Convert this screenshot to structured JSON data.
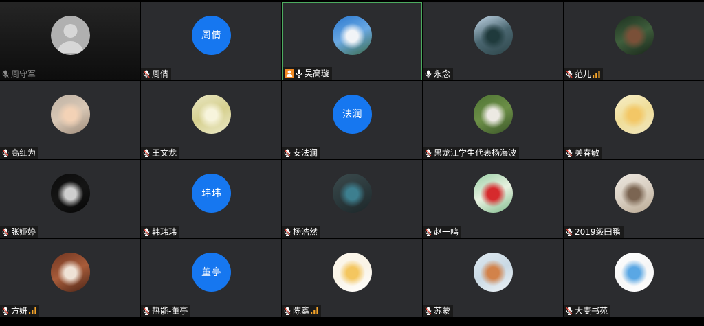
{
  "colors": {
    "page_background": "#000000",
    "tile_background": "#2b2c2f",
    "label_background": "#1a1a1a",
    "active_speaker_border": "#4cab5f",
    "text_avatar_background": "#1677f0",
    "mic_muted_slash": "#e6483a",
    "host_badge": "#f28b24",
    "signal_bars": "#f3a32a",
    "dimmed_label_text": "#8c8c8c"
  },
  "participants": [
    {
      "name": "周守军",
      "mic_icon": "mic-muted-icon",
      "dimmed": true,
      "avatar": {
        "icon": "default-user-icon",
        "colors": [
          "#b0b0b0",
          "#d7d7d7"
        ]
      }
    },
    {
      "name": "周倩",
      "mic_icon": "mic-muted-icon",
      "avatar": {
        "text": "周倩"
      }
    },
    {
      "name": "吴高璇",
      "mic_icon": "mic-on-icon",
      "host_icon": "host-icon",
      "active_speaker": true,
      "avatar": {
        "photo_colors": [
          "#2a78d0",
          "#6aa8e2",
          "#3b6b4a"
        ],
        "subject_color": "#f1f4f7"
      }
    },
    {
      "name": "永念",
      "mic_icon": "mic-on-icon",
      "avatar": {
        "photo_colors": [
          "#c5d9ea",
          "#4a6670",
          "#2d4549"
        ],
        "subject_color": "#1f3a3c"
      }
    },
    {
      "name": "范儿",
      "mic_icon": "mic-muted-icon",
      "signal_icon": "network-signal-icon",
      "avatar": {
        "photo_colors": [
          "#1c2f1f",
          "#3f5e3c",
          "#182519"
        ],
        "subject_color": "#7a5038"
      }
    },
    {
      "name": "高红为",
      "mic_icon": "mic-muted-icon",
      "avatar": {
        "photo_colors": [
          "#bfb2a4",
          "#d8c7b5",
          "#9d8b7a"
        ],
        "subject_color": "#f3d2b6"
      }
    },
    {
      "name": "王文龙",
      "mic_icon": "mic-muted-icon",
      "avatar": {
        "photo_colors": [
          "#e9e6c2",
          "#d6d08f",
          "#eceac9"
        ],
        "subject_color": "#f7f4dc"
      }
    },
    {
      "name": "安法润",
      "mic_icon": "mic-muted-icon",
      "avatar": {
        "text": "法润"
      }
    },
    {
      "name": "黑龙江学生代表杨海波",
      "mic_icon": "mic-muted-icon",
      "avatar": {
        "photo_colors": [
          "#4f7434",
          "#6c8f47",
          "#3a5528"
        ],
        "subject_color": "#ece9e2"
      }
    },
    {
      "name": "关春敏",
      "mic_icon": "mic-muted-icon",
      "avatar": {
        "photo_colors": [
          "#f6eec8",
          "#f0dd98",
          "#efe6bd"
        ],
        "subject_color": "#f3c766"
      }
    },
    {
      "name": "张娅婷",
      "mic_icon": "mic-muted-icon",
      "avatar": {
        "photo_colors": [
          "#0b0b0b",
          "#151515",
          "#050505"
        ],
        "subject_color": "#cfcfcf"
      }
    },
    {
      "name": "韩玮玮",
      "mic_icon": "mic-muted-icon",
      "avatar": {
        "text": "玮玮"
      }
    },
    {
      "name": "杨浩然",
      "mic_icon": "mic-muted-icon",
      "avatar": {
        "photo_colors": [
          "#3b4a4c",
          "#2c3a3d",
          "#1d2729"
        ],
        "subject_color": "#3d7f8f"
      }
    },
    {
      "name": "赵一鸣",
      "mic_icon": "mic-muted-icon",
      "avatar": {
        "photo_colors": [
          "#9acfa6",
          "#e8f1e0",
          "#7fbb8c"
        ],
        "subject_color": "#d62a2d"
      }
    },
    {
      "name": "2019级田鹏",
      "mic_icon": "mic-muted-icon",
      "avatar": {
        "photo_colors": [
          "#ece7df",
          "#d9cfc2",
          "#b9a993"
        ],
        "subject_color": "#7b6552"
      }
    },
    {
      "name": "方妍",
      "mic_icon": "mic-muted-icon",
      "signal_icon": "network-signal-icon",
      "avatar": {
        "photo_colors": [
          "#6e3420",
          "#a85c3a",
          "#4b2416"
        ],
        "subject_color": "#efe2d6"
      }
    },
    {
      "name": "热能-董亭",
      "mic_icon": "mic-muted-icon",
      "avatar": {
        "text": "董亭"
      }
    },
    {
      "name": "陈鑫",
      "mic_icon": "mic-muted-icon",
      "signal_icon": "network-signal-icon",
      "avatar": {
        "photo_colors": [
          "#fdf8ee",
          "#f9f3e6",
          "#ffffff"
        ],
        "subject_color": "#f4c65f"
      }
    },
    {
      "name": "苏蒙",
      "mic_icon": "mic-muted-icon",
      "avatar": {
        "photo_colors": [
          "#dfe9f0",
          "#c9d9e4",
          "#eef3f6"
        ],
        "subject_color": "#d2824a"
      }
    },
    {
      "name": "大麦书苑",
      "mic_icon": "mic-muted-icon",
      "avatar": {
        "photo_colors": [
          "#ffffff",
          "#f6f6f6",
          "#ffffff"
        ],
        "subject_color": "#5aa7e4"
      }
    }
  ]
}
